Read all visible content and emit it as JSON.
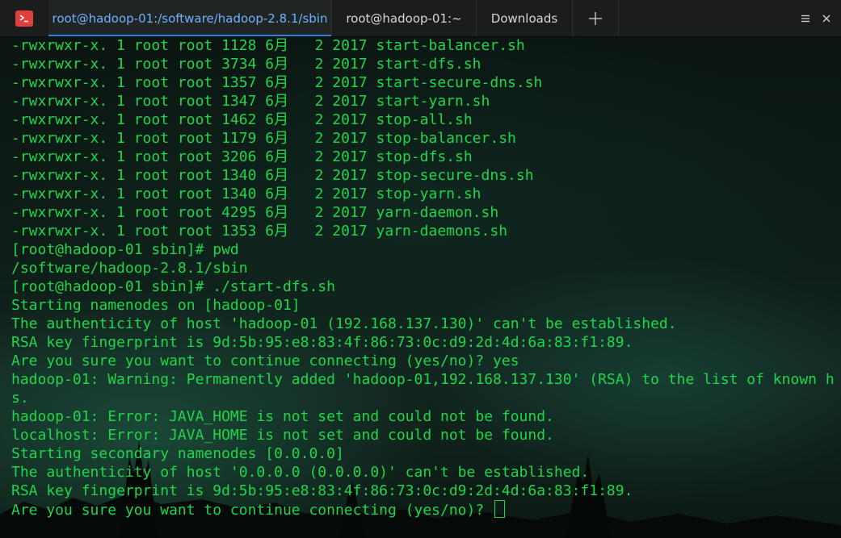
{
  "tabs": [
    {
      "label": "root@hadoop-01:/software/hadoop-2.8.1/sbin",
      "active": true
    },
    {
      "label": "root@hadoop-01:~",
      "active": false
    },
    {
      "label": "Downloads",
      "active": false
    }
  ],
  "icons": {
    "app": "terminal-app-icon",
    "new_tab": "plus-icon",
    "menu": "hamburger-menu-icon",
    "close": "close-icon"
  },
  "colors": {
    "terminal_text": "#1fd64a",
    "active_tab_text": "#6fb0ff",
    "active_tab_underline": "#2d7fe0",
    "app_icon": "#e0403c"
  },
  "terminal": {
    "lines": [
      "-rwxrwxr-x. 1 root root 1128 6月   2 2017 start-balancer.sh",
      "-rwxrwxr-x. 1 root root 3734 6月   2 2017 start-dfs.sh",
      "-rwxrwxr-x. 1 root root 1357 6月   2 2017 start-secure-dns.sh",
      "-rwxrwxr-x. 1 root root 1347 6月   2 2017 start-yarn.sh",
      "-rwxrwxr-x. 1 root root 1462 6月   2 2017 stop-all.sh",
      "-rwxrwxr-x. 1 root root 1179 6月   2 2017 stop-balancer.sh",
      "-rwxrwxr-x. 1 root root 3206 6月   2 2017 stop-dfs.sh",
      "-rwxrwxr-x. 1 root root 1340 6月   2 2017 stop-secure-dns.sh",
      "-rwxrwxr-x. 1 root root 1340 6月   2 2017 stop-yarn.sh",
      "-rwxrwxr-x. 1 root root 4295 6月   2 2017 yarn-daemon.sh",
      "-rwxrwxr-x. 1 root root 1353 6月   2 2017 yarn-daemons.sh",
      "[root@hadoop-01 sbin]# pwd",
      "/software/hadoop-2.8.1/sbin",
      "[root@hadoop-01 sbin]# ./start-dfs.sh",
      "Starting namenodes on [hadoop-01]",
      "The authenticity of host 'hadoop-01 (192.168.137.130)' can't be established.",
      "RSA key fingerprint is 9d:5b:95:e8:83:4f:86:73:0c:d9:2d:4d:6a:83:f1:89.",
      "Are you sure you want to continue connecting (yes/no)? yes",
      "hadoop-01: Warning: Permanently added 'hadoop-01,192.168.137.130' (RSA) to the list of known h",
      "s.",
      "hadoop-01: Error: JAVA_HOME is not set and could not be found.",
      "localhost: Error: JAVA_HOME is not set and could not be found.",
      "Starting secondary namenodes [0.0.0.0]",
      "The authenticity of host '0.0.0.0 (0.0.0.0)' can't be established.",
      "RSA key fingerprint is 9d:5b:95:e8:83:4f:86:73:0c:d9:2d:4d:6a:83:f1:89."
    ],
    "prompt_line": "Are you sure you want to continue connecting (yes/no)? "
  }
}
